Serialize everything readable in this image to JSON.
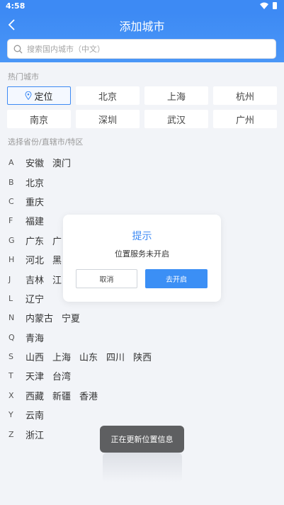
{
  "status_bar": {
    "time": "4:58"
  },
  "header": {
    "title": "添加城市"
  },
  "search": {
    "placeholder": "搜索国内城市（中文）"
  },
  "hot_cities": {
    "label": "热门城市",
    "locate_label": "定位",
    "cities": [
      "北京",
      "上海",
      "杭州",
      "南京",
      "深圳",
      "武汉",
      "广州"
    ]
  },
  "province_section": {
    "label": "选择省份/直辖市/特区"
  },
  "letters": [
    {
      "letter": "A",
      "provinces": [
        "安徽",
        "澳门"
      ]
    },
    {
      "letter": "B",
      "provinces": [
        "北京"
      ]
    },
    {
      "letter": "C",
      "provinces": [
        "重庆"
      ]
    },
    {
      "letter": "F",
      "provinces": [
        "福建"
      ]
    },
    {
      "letter": "G",
      "provinces": [
        "广东",
        "广"
      ]
    },
    {
      "letter": "H",
      "provinces": [
        "河北",
        "黑"
      ]
    },
    {
      "letter": "J",
      "provinces": [
        "吉林",
        "江"
      ]
    },
    {
      "letter": "L",
      "provinces": [
        "辽宁"
      ]
    },
    {
      "letter": "N",
      "provinces": [
        "内蒙古",
        "宁夏"
      ]
    },
    {
      "letter": "Q",
      "provinces": [
        "青海"
      ]
    },
    {
      "letter": "S",
      "provinces": [
        "山西",
        "上海",
        "山东",
        "四川",
        "陕西"
      ]
    },
    {
      "letter": "T",
      "provinces": [
        "天津",
        "台湾"
      ]
    },
    {
      "letter": "X",
      "provinces": [
        "西藏",
        "新疆",
        "香港"
      ]
    },
    {
      "letter": "Y",
      "provinces": [
        "云南"
      ]
    },
    {
      "letter": "Z",
      "provinces": [
        "浙江"
      ]
    }
  ],
  "dialog": {
    "title": "提示",
    "message": "位置服务未开启",
    "cancel_label": "取消",
    "confirm_label": "去开启"
  },
  "toast": {
    "message": "正在更新位置信息"
  },
  "colors": {
    "primary": "#3d8af4",
    "background": "#f2f4f8",
    "toast": "#5e5f61"
  }
}
